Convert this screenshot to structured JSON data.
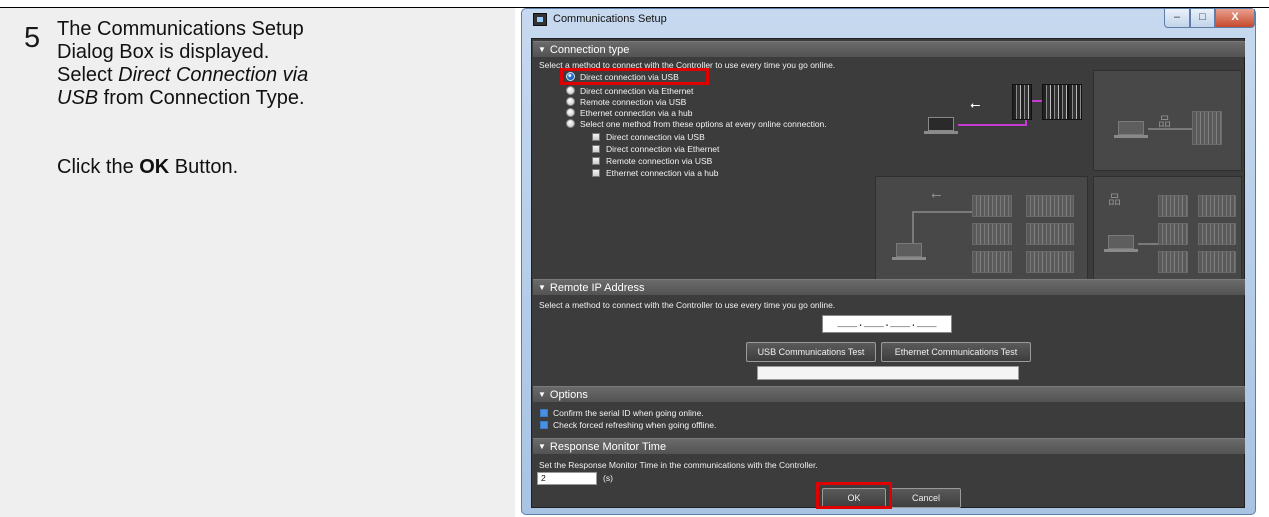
{
  "step": {
    "number": "5",
    "line1": "The Communications Setup",
    "line2": "Dialog Box is displayed.",
    "line3_pre": "Select ",
    "line3_em": "Direct Connection via",
    "line4_em": "USB",
    "line4_post": " from Connection Type.",
    "click_pre": "Click the ",
    "click_bold": "OK",
    "click_post": " Button."
  },
  "dialog": {
    "title": "Communications Setup",
    "window_buttons": {
      "minimize": "–",
      "maximize": "□",
      "close": "X"
    },
    "connection_type": {
      "header": "Connection type",
      "description": "Select a method to connect with the Controller to use every time you go online.",
      "selected_option": "Direct connection via USB",
      "options": [
        "Direct connection via USB",
        "Direct connection via Ethernet",
        "Remote connection via USB",
        "Ethernet connection via a hub",
        "Select one method from these options at every online connection."
      ],
      "sub_options": [
        "Direct connection via USB",
        "Direct connection via Ethernet",
        "Remote connection via USB",
        "Ethernet connection via a hub"
      ]
    },
    "remote_ip": {
      "header": "Remote IP Address",
      "description": "Select a method to connect with the Controller to use every time you go online.",
      "ip_placeholder": "___.___.___.___",
      "usb_test_label": "USB Communications Test",
      "ethernet_test_label": "Ethernet Communications Test"
    },
    "options": {
      "header": "Options",
      "items": [
        {
          "label": "Confirm the serial ID when going online.",
          "checked": true
        },
        {
          "label": "Check forced refreshing when going offline.",
          "checked": true
        }
      ]
    },
    "response_monitor": {
      "header": "Response Monitor Time",
      "description": "Set the Response Monitor Time in the communications with the Controller.",
      "value": "2",
      "unit": "(s)"
    },
    "ok_label": "OK",
    "cancel_label": "Cancel"
  },
  "colors": {
    "highlight": "#e10000",
    "usb_link": "#c43bd1",
    "selected_radio": "#2e7fd8"
  },
  "icons": [
    "window-app-icon",
    "usb-icon",
    "network-hub-icon",
    "laptop-icon",
    "controller-icon"
  ]
}
